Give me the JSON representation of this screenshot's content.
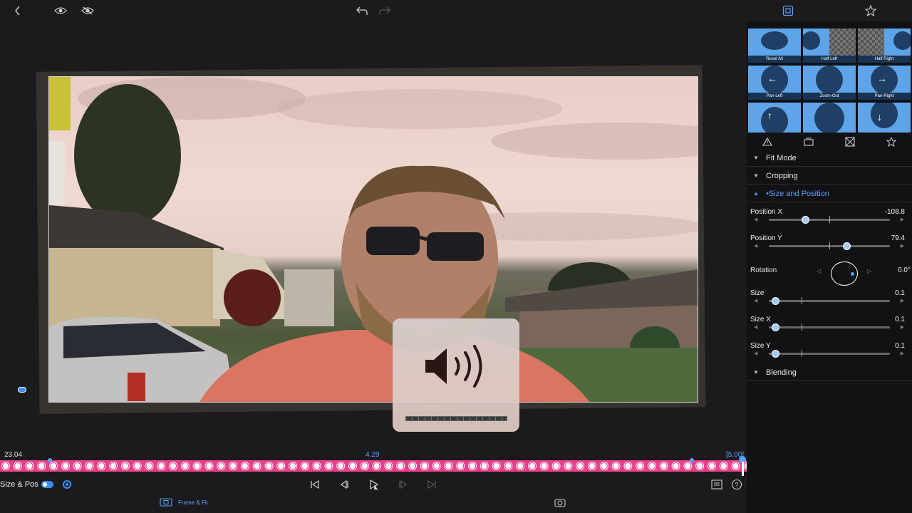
{
  "toolbar": {
    "icons": [
      "back-icon",
      "eye-icon",
      "eye-slash-icon",
      "undo-icon",
      "redo-icon",
      "frame-icon",
      "star-icon"
    ]
  },
  "timeline": {
    "left_time": "23.04",
    "center_time": "4.29",
    "right_time": "[5.00]"
  },
  "controls": {
    "mode_label": "Size & Pos"
  },
  "bottom": {
    "mode_tab": "Frame & Fit"
  },
  "presets": [
    {
      "label": "Reset All"
    },
    {
      "label": "Half Left"
    },
    {
      "label": "Half Right"
    },
    {
      "label": "Pan-Left"
    },
    {
      "label": "Zoom-Out"
    },
    {
      "label": "Pan-Right"
    },
    {
      "label": ""
    },
    {
      "label": ""
    },
    {
      "label": ""
    }
  ],
  "sections": {
    "fit_mode": "Fit Mode",
    "cropping": "Cropping",
    "size_position": "•Size and Position",
    "blending": "Blending"
  },
  "params": {
    "position_x": {
      "label": "Position X",
      "value": "-108.8",
      "level": 0.3
    },
    "position_y": {
      "label": "Position Y",
      "value": "79.4",
      "level": 0.64
    },
    "rotation": {
      "label": "Rotation",
      "value": "0.0°"
    },
    "size": {
      "label": "Size",
      "value": "0.1",
      "level": 0.05
    },
    "size_x": {
      "label": "Size X",
      "value": "0.1",
      "level": 0.05
    },
    "size_y": {
      "label": "Size Y",
      "value": "0.1",
      "level": 0.05
    }
  },
  "volume_hud": {
    "level": 1.0
  }
}
